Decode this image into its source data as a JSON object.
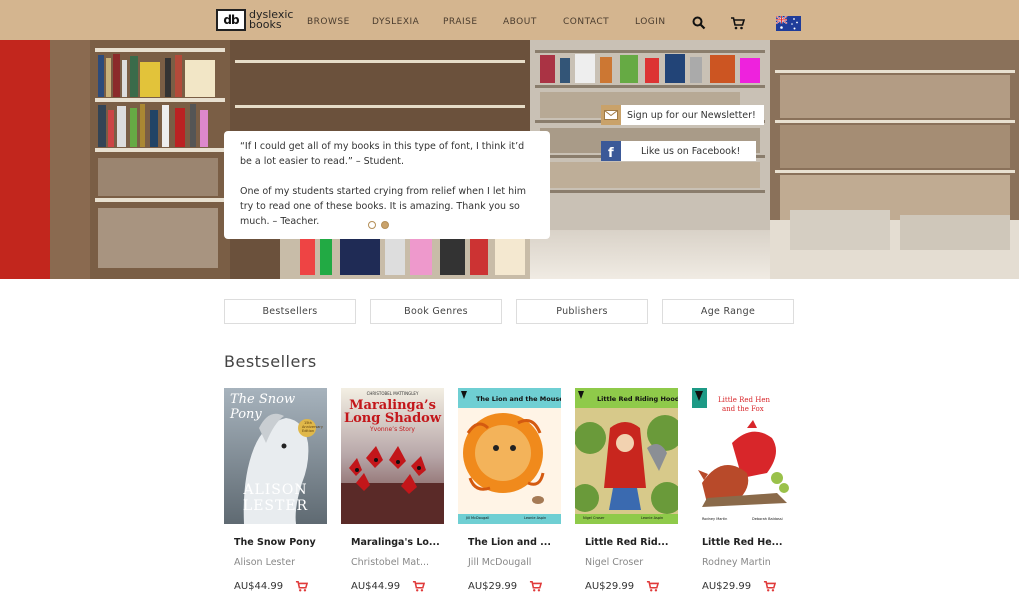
{
  "nav": {
    "logo_letters": "db",
    "logo_text_line1": "dyslexic",
    "logo_text_line2": "books",
    "links": [
      "BROWSE",
      "DYSLEXIA",
      "PRAISE",
      "ABOUT",
      "CONTACT",
      "LOGIN"
    ]
  },
  "hero": {
    "quote1": "“If I could get all of my books in this type of font, I think it’d be a lot easier to read.” – Student.",
    "quote2": "One of my students started crying from relief when I let him try to read one of these books. It is amazing. Thank you so much. – Teacher.",
    "newsletter_label": "Sign up for our Newsletter!",
    "facebook_label": "Like us on Facebook!",
    "carousel_active_index": 1
  },
  "filters": [
    "Bestsellers",
    "Book Genres",
    "Publishers",
    "Age Range"
  ],
  "section_title": "Bestsellers",
  "books": [
    {
      "title": "The Snow Pony",
      "author": "Alison Lester",
      "price": "AU$44.99",
      "cover_title": "The Snow Pony",
      "cover_author": "ALISON LESTER",
      "cover_badge": "15th Anniversary Edition"
    },
    {
      "title": "Maralinga's Lo...",
      "author": "Christobel Mat...",
      "price": "AU$44.99",
      "cover_author": "CHRISTOBEL MATTINGLEY",
      "cover_title_line1": "Maralinga’s",
      "cover_title_line2": "Long Shadow",
      "cover_subtitle": "Yvonne’s Story"
    },
    {
      "title": "The Lion and ...",
      "author": "Jill McDougall",
      "price": "AU$29.99",
      "cover_title": "The Lion and the Mouse",
      "cover_author": "Jill McDougall",
      "cover_illustrator": "Leonie Aspin"
    },
    {
      "title": "Little Red Rid...",
      "author": "Nigel Croser",
      "price": "AU$29.99",
      "cover_title": "Little Red Riding Hood",
      "cover_author": "Nigel Croser",
      "cover_illustrator": "Leonie Aspin"
    },
    {
      "title": "Little Red He...",
      "author": "Rodney Martin",
      "price": "AU$29.99",
      "cover_title_line1": "Little Red Hen",
      "cover_title_line2": "and the Fox",
      "cover_author": "Rodney Martin",
      "cover_illustrator": "Deborah Baldassi"
    }
  ],
  "colors": {
    "nav_bg": "#d4b58f",
    "cart_red": "#e03a3a",
    "accent_gold": "#c9a26a"
  }
}
